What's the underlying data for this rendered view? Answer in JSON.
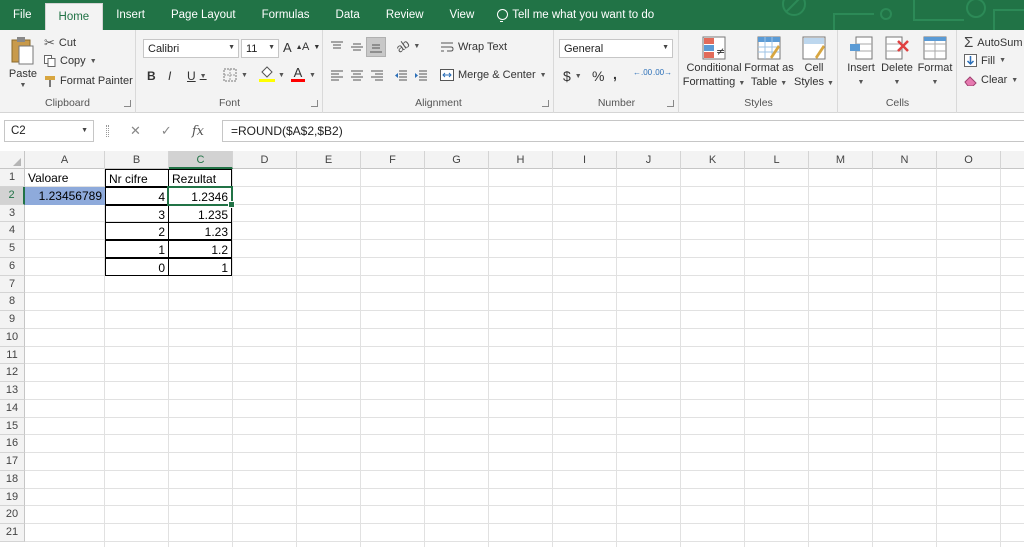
{
  "tabs": [
    {
      "label": "File",
      "active": false
    },
    {
      "label": "Home",
      "active": true
    },
    {
      "label": "Insert",
      "active": false
    },
    {
      "label": "Page Layout",
      "active": false
    },
    {
      "label": "Formulas",
      "active": false
    },
    {
      "label": "Data",
      "active": false
    },
    {
      "label": "Review",
      "active": false
    },
    {
      "label": "View",
      "active": false
    }
  ],
  "tell_me": "Tell me what you want to do",
  "ribbon": {
    "clipboard": {
      "label": "Clipboard",
      "paste": "Paste",
      "cut": "Cut",
      "copy": "Copy",
      "format_painter": "Format Painter"
    },
    "font": {
      "label": "Font",
      "font_name": "Calibri",
      "font_size": "11",
      "bold": "B",
      "italic": "I",
      "underline": "U",
      "grow": "A",
      "shrink": "A",
      "font_color_letter": "A"
    },
    "alignment": {
      "label": "Alignment",
      "wrap_text": "Wrap Text",
      "merge_center": "Merge & Center"
    },
    "number": {
      "label": "Number",
      "format": "General",
      "currency": "$",
      "percent": "%",
      "comma": ",",
      "inc_decimal": ".00",
      "dec_decimal": ".00"
    },
    "styles": {
      "label": "Styles",
      "conditional_1": "Conditional",
      "conditional_2": "Formatting",
      "format_table_1": "Format as",
      "format_table_2": "Table",
      "cell_styles_1": "Cell",
      "cell_styles_2": "Styles"
    },
    "cells": {
      "label": "Cells",
      "insert": "Insert",
      "delete": "Delete",
      "format": "Format"
    },
    "editing": {
      "autosum": "AutoSum",
      "fill": "Fill",
      "clear": "Clear"
    }
  },
  "formula_bar": {
    "name_box": "C2",
    "cancel": "✕",
    "enter": "✓",
    "fx": "fx",
    "formula": "=ROUND($A$2,$B2)"
  },
  "columns": [
    "A",
    "B",
    "C",
    "D",
    "E",
    "F",
    "G",
    "H",
    "I",
    "J",
    "K",
    "L",
    "M",
    "N",
    "O"
  ],
  "rows": [
    "1",
    "2",
    "3",
    "4",
    "5",
    "6",
    "7",
    "8",
    "9",
    "10",
    "11",
    "12",
    "13",
    "14",
    "15",
    "16",
    "17",
    "18",
    "19",
    "20",
    "21"
  ],
  "selected": {
    "column": "C",
    "row": "2"
  },
  "sheet": {
    "headers": {
      "a1": "Valoare",
      "b1": "Nr cifre",
      "c1": "Rezultat"
    },
    "a2": "1.23456789",
    "rows": [
      {
        "digits": "4",
        "result": "1.2346"
      },
      {
        "digits": "3",
        "result": "1.235"
      },
      {
        "digits": "2",
        "result": "1.23"
      },
      {
        "digits": "1",
        "result": "1.2"
      },
      {
        "digits": "0",
        "result": "1"
      }
    ]
  },
  "colors": {
    "accent": "#217346",
    "highlight": "#8eaadb"
  }
}
